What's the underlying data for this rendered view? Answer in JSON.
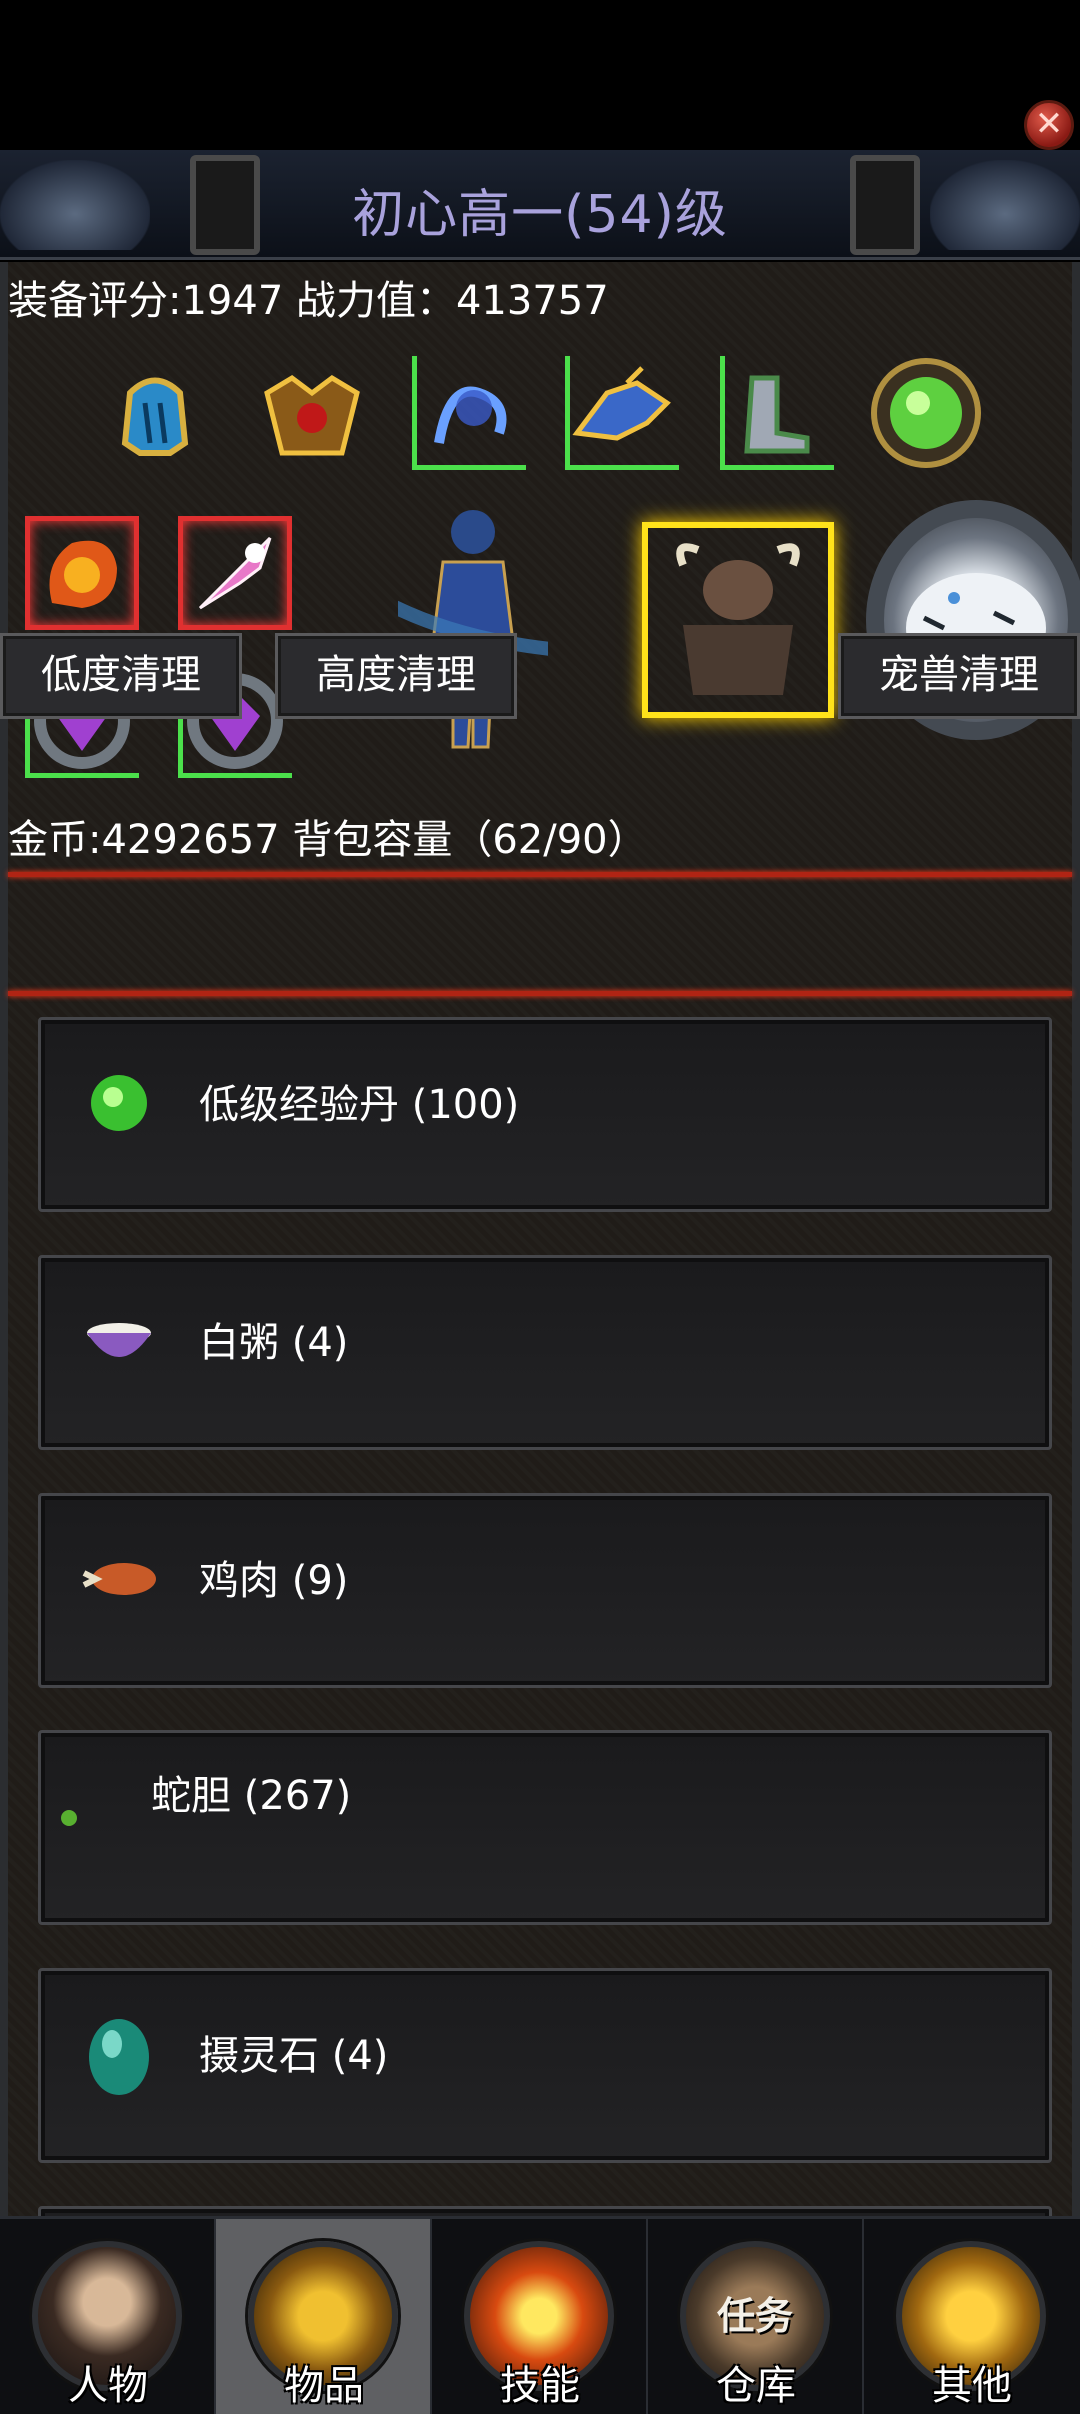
{
  "header": {
    "title": "初心高一(54)级",
    "close_icon": "close-icon"
  },
  "stats": {
    "score_line": "装备评分:1947 战力值：413757",
    "gold_line": "金币:4292657 背包容量（62/90）"
  },
  "equipment": {
    "slots": [
      {
        "name": "helmet-icon",
        "frame": "none"
      },
      {
        "name": "armor-icon",
        "frame": "none"
      },
      {
        "name": "whip-icon",
        "frame": "green"
      },
      {
        "name": "dragon-helm-icon",
        "frame": "green"
      },
      {
        "name": "boots-icon",
        "frame": "green"
      },
      {
        "name": "green-orb-icon",
        "frame": "none"
      },
      {
        "name": "flame-bracelet-icon",
        "frame": "red"
      },
      {
        "name": "pink-crystal-icon",
        "frame": "red"
      },
      {
        "name": "purple-ring-icon",
        "frame": "green"
      },
      {
        "name": "purple-ring-icon",
        "frame": "green"
      }
    ],
    "character_icon": "warrior-character-icon",
    "pet_icon": "minotaur-pet-icon",
    "mount_icon": "white-tiger-icon"
  },
  "cleanup": {
    "low_label": "低度清理",
    "high_label": "高度清理",
    "pet_label": "宠兽清理"
  },
  "inventory": [
    {
      "icon": "green-orb-icon",
      "label": "低级经验丹 (100)"
    },
    {
      "icon": "porridge-bowl-icon",
      "label": "白粥 (4)"
    },
    {
      "icon": "chicken-meat-icon",
      "label": "鸡肉 (9)"
    },
    {
      "icon": "snake-bile-icon",
      "label": "蛇胆 (267)"
    },
    {
      "icon": "spirit-stone-icon",
      "label": "摄灵石 (4)"
    }
  ],
  "nav": {
    "tabs": [
      {
        "label": "人物",
        "icon": "character-portrait-icon"
      },
      {
        "label": "物品",
        "icon": "golden-armor-icon"
      },
      {
        "label": "技能",
        "icon": "sword-burst-icon"
      },
      {
        "label": "仓库",
        "icon": "treasure-chest-icon",
        "badge": "任务"
      },
      {
        "label": "其他",
        "icon": "trophy-icon"
      }
    ],
    "active_index": 1
  },
  "colors": {
    "title": "#a9a2dc",
    "separator": "#b02414",
    "green_frame": "#4be04b",
    "red_frame": "#e03030",
    "gold_frame": "#ffe21a"
  }
}
